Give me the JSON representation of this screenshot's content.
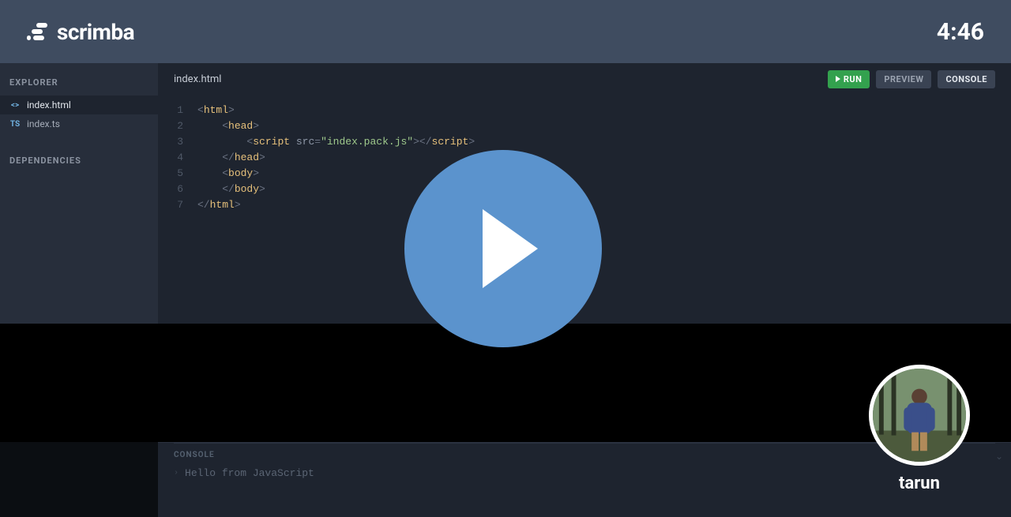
{
  "header": {
    "brand": "scrimba",
    "time": "4:46"
  },
  "sidebar": {
    "explorer_label": "EXPLORER",
    "dependencies_label": "DEPENDENCIES",
    "files": [
      {
        "name": "index.html",
        "icon": "<>",
        "active": true,
        "icon_class": "html"
      },
      {
        "name": "index.ts",
        "icon": "TS",
        "active": false,
        "icon_class": "ts"
      }
    ]
  },
  "editor": {
    "open_file": "index.html",
    "actions": {
      "run_label": "RUN",
      "preview_label": "PREVIEW",
      "console_label": "CONSOLE"
    },
    "code_lines": [
      {
        "num": "1",
        "indent": 0,
        "open": "html"
      },
      {
        "num": "2",
        "indent": 1,
        "open": "head"
      },
      {
        "num": "3",
        "indent": 2,
        "open": "script",
        "attr": "src",
        "val": "\"index.pack.js\"",
        "self_close_pair": true
      },
      {
        "num": "4",
        "indent": 1,
        "close": "head"
      },
      {
        "num": "5",
        "indent": 1,
        "open": "body"
      },
      {
        "num": "6",
        "indent": 1,
        "close": "body"
      },
      {
        "num": "7",
        "indent": 0,
        "close": "html"
      }
    ]
  },
  "console": {
    "heading": "CONSOLE",
    "output": "Hello from JavaScript"
  },
  "author": {
    "name": "tarun"
  }
}
